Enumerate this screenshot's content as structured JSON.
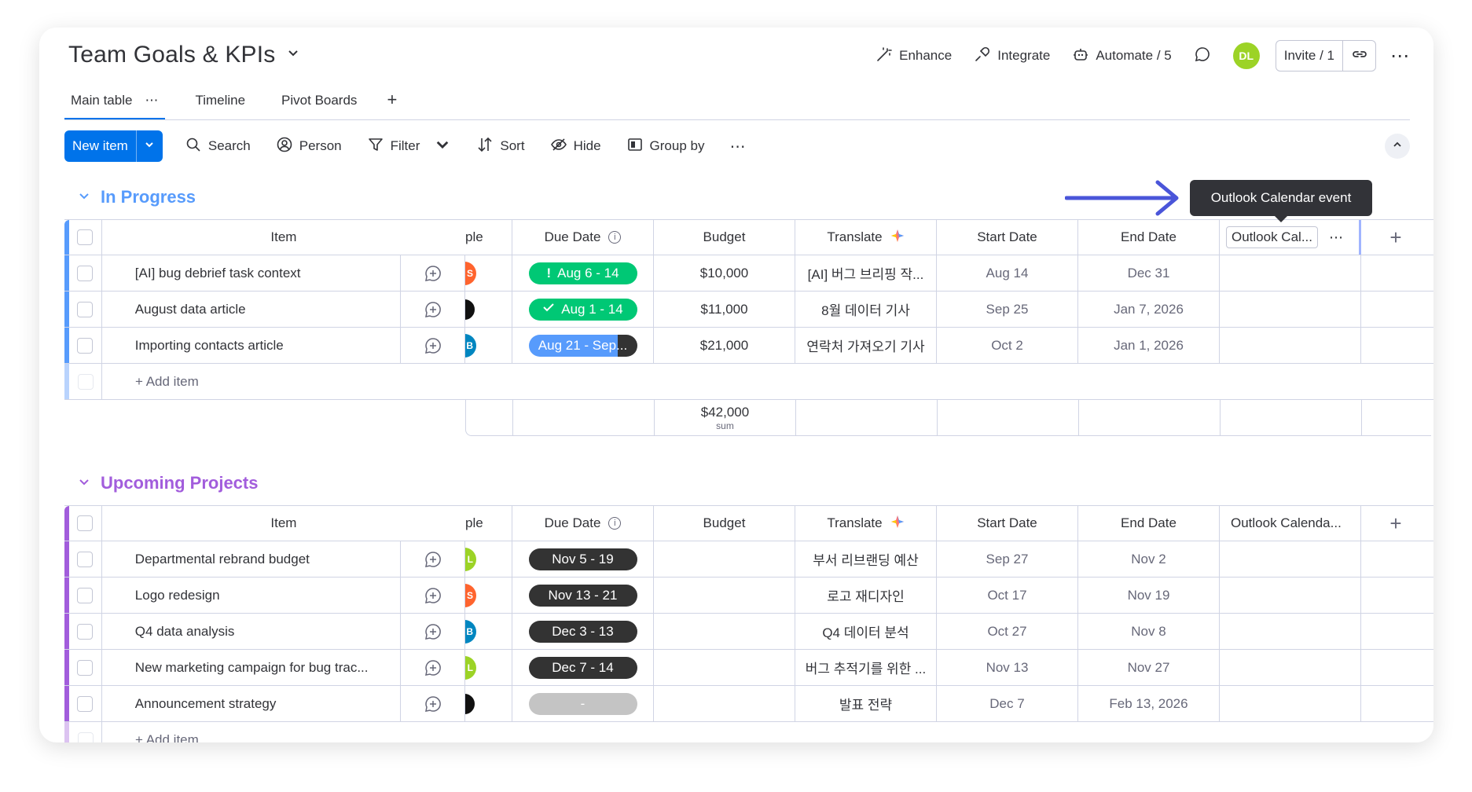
{
  "board": {
    "title": "Team Goals & KPIs"
  },
  "header": {
    "enhance": "Enhance",
    "integrate": "Integrate",
    "automate": "Automate / 5",
    "avatar": "DL",
    "invite": "Invite / 1"
  },
  "tabs": [
    {
      "label": "Main table"
    },
    {
      "label": "Timeline"
    },
    {
      "label": "Pivot Boards"
    }
  ],
  "toolbar": {
    "new_item": "New item",
    "search": "Search",
    "person": "Person",
    "filter": "Filter",
    "sort": "Sort",
    "hide": "Hide",
    "group_by": "Group by"
  },
  "columns": {
    "item": "Item",
    "people": "ple",
    "due_date": "Due Date",
    "budget": "Budget",
    "translate": "Translate",
    "start_date": "Start Date",
    "end_date": "End Date",
    "outlook_short": "Outlook Cal...",
    "outlook_long": "Outlook Calenda..."
  },
  "tooltip": "Outlook Calendar event",
  "group1": {
    "title": "In Progress",
    "color": "#579bfc",
    "rows": [
      {
        "item": "[AI] bug debrief task context",
        "avatar": "S",
        "due": "Aug 6 - 14",
        "budget": "$10,000",
        "translate": "[AI] 버그 브리핑 작...",
        "start": "Aug 14",
        "end": "Dec 31"
      },
      {
        "item": "August data article",
        "avatar": "",
        "due": "Aug 1 - 14",
        "budget": "$11,000",
        "translate": "8월 데이터 기사",
        "start": "Sep 25",
        "end": "Jan 7, 2026"
      },
      {
        "item": "Importing contacts article",
        "avatar": "B",
        "due": "Aug 21 - Sep...",
        "budget": "$21,000",
        "translate": "연락처 가져오기 기사",
        "start": "Oct 2",
        "end": "Jan 1, 2026"
      }
    ],
    "add_item": "+ Add item",
    "sum_value": "$42,000",
    "sum_label": "sum"
  },
  "group2": {
    "title": "Upcoming Projects",
    "color": "#a25ddc",
    "rows": [
      {
        "item": "Departmental rebrand budget",
        "avatar": "L",
        "due": "Nov 5 - 19",
        "translate": "부서 리브랜딩 예산",
        "start": "Sep 27",
        "end": "Nov 2"
      },
      {
        "item": "Logo redesign",
        "avatar": "S",
        "due": "Nov 13 - 21",
        "translate": "로고 재디자인",
        "start": "Oct 17",
        "end": "Nov 19"
      },
      {
        "item": "Q4 data analysis",
        "avatar": "B",
        "due": "Dec 3 - 13",
        "translate": "Q4 데이터 분석",
        "start": "Oct 27",
        "end": "Nov 8"
      },
      {
        "item": "New marketing campaign for bug trac...",
        "avatar": "L",
        "due": "Dec 7 - 14",
        "translate": "버그 추적기를 위한 ...",
        "start": "Nov 13",
        "end": "Nov 27"
      },
      {
        "item": "Announcement strategy",
        "avatar": "",
        "due": "-",
        "translate": "발표 전략",
        "start": "Dec 7",
        "end": "Feb 13, 2026"
      }
    ],
    "add_item": "+ Add item"
  },
  "colors": {
    "primary": "#0073ea",
    "green": "#00c875",
    "dark_pill": "#333333",
    "arrow": "#4a55d9"
  },
  "icons": [
    "chevron-down-icon",
    "enhance-wand-icon",
    "integrate-plug-icon",
    "robot-icon",
    "chat-bubble-icon",
    "link-icon",
    "more-icon",
    "search-icon",
    "person-icon",
    "filter-icon",
    "sort-icon",
    "hide-eye-icon",
    "group-by-icon",
    "add-update-icon",
    "info-icon",
    "sparkle-icon",
    "plus-icon",
    "check-icon",
    "exclamation-icon"
  ]
}
